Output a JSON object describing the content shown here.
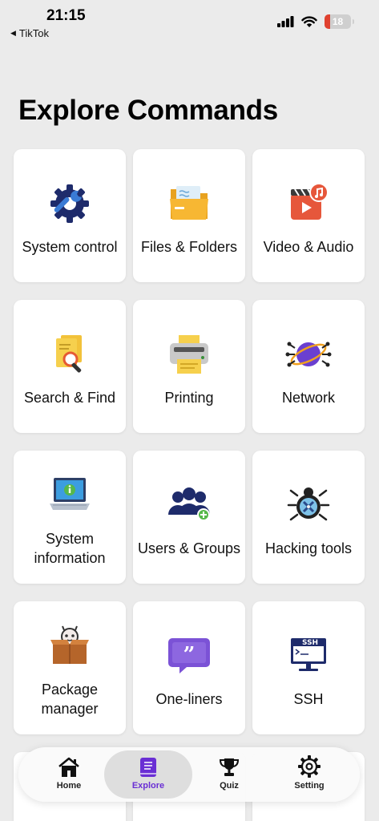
{
  "status": {
    "time": "21:15",
    "back_label": "TikTok",
    "battery": "18"
  },
  "page": {
    "title": "Explore Commands"
  },
  "tiles": [
    {
      "label": "System control",
      "icon": "gear-wrench-icon"
    },
    {
      "label": "Files & Folders",
      "icon": "folder-icon"
    },
    {
      "label": "Video & Audio",
      "icon": "video-audio-icon"
    },
    {
      "label": "Search & Find",
      "icon": "search-document-icon"
    },
    {
      "label": "Printing",
      "icon": "printer-icon"
    },
    {
      "label": "Network",
      "icon": "globe-network-icon"
    },
    {
      "label": "System information",
      "icon": "laptop-info-icon"
    },
    {
      "label": "Users & Groups",
      "icon": "users-group-icon"
    },
    {
      "label": "Hacking tools",
      "icon": "bug-tools-icon"
    },
    {
      "label": "Package manager",
      "icon": "package-icon"
    },
    {
      "label": "One-liners",
      "icon": "quote-bubble-icon"
    },
    {
      "label": "SSH",
      "icon": "ssh-terminal-icon"
    }
  ],
  "tabs": [
    {
      "label": "Home",
      "icon": "home-icon"
    },
    {
      "label": "Explore",
      "icon": "book-icon"
    },
    {
      "label": "Quiz",
      "icon": "trophy-icon"
    },
    {
      "label": "Setting",
      "icon": "settings-gear-icon"
    }
  ],
  "colors": {
    "accent": "#6a2fd4",
    "background": "#ebebeb",
    "battery_low": "#e0412f"
  }
}
